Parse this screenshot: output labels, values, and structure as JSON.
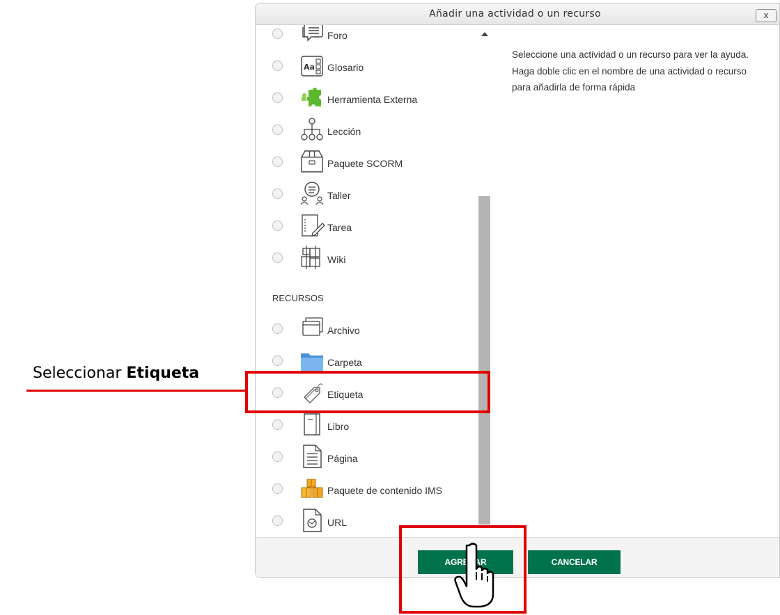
{
  "dialog": {
    "title": "Añadir una actividad o un recurso",
    "close_label": "x",
    "help_text": "Seleccione una actividad o un recurso para ver la ayuda. Haga doble clic en el nombre de una actividad o recurso para añadirla de forma rápida"
  },
  "activities": [
    {
      "label": "Foro",
      "icon": "forum-icon"
    },
    {
      "label": "Glosario",
      "icon": "glossary-icon"
    },
    {
      "label": "Herramienta Externa",
      "icon": "puzzle-icon",
      "color": "#5cb82e"
    },
    {
      "label": "Lección",
      "icon": "lesson-icon"
    },
    {
      "label": "Paquete SCORM",
      "icon": "scorm-package-icon"
    },
    {
      "label": "Taller",
      "icon": "workshop-icon"
    },
    {
      "label": "Tarea",
      "icon": "assignment-icon"
    },
    {
      "label": "Wiki",
      "icon": "wiki-icon"
    }
  ],
  "resources_heading": "RECURSOS",
  "resources": [
    {
      "label": "Archivo",
      "icon": "file-icon"
    },
    {
      "label": "Carpeta",
      "icon": "folder-icon",
      "color": "#5b9bd5"
    },
    {
      "label": "Etiqueta",
      "icon": "label-tag-icon"
    },
    {
      "label": "Libro",
      "icon": "book-icon"
    },
    {
      "label": "Página",
      "icon": "page-icon"
    },
    {
      "label": "Paquete de contenido IMS",
      "icon": "ims-package-icon",
      "color": "#f5a623"
    },
    {
      "label": "URL",
      "icon": "url-icon"
    }
  ],
  "footer": {
    "add_label": "AGREGAR",
    "cancel_label": "CANCELAR",
    "button_color": "#00734c"
  },
  "annotation": {
    "text_prefix": "Seleccionar ",
    "text_bold": "Etiqueta",
    "highlight_color": "#e00000"
  }
}
